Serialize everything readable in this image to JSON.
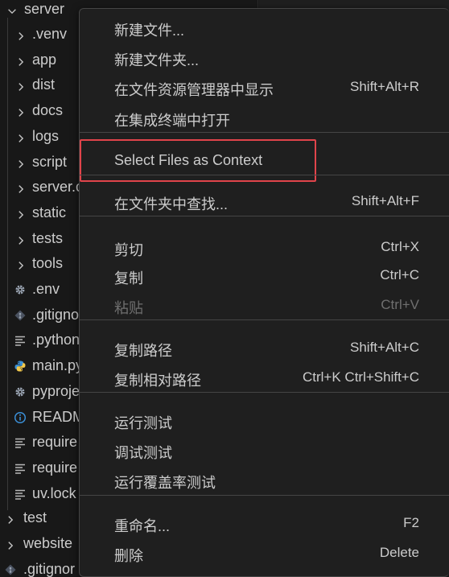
{
  "explorer": {
    "root": {
      "label": "server",
      "icon": "chevron-down-icon"
    },
    "items": [
      {
        "label": ".venv",
        "kind": "folder"
      },
      {
        "label": "app",
        "kind": "folder"
      },
      {
        "label": "dist",
        "kind": "folder"
      },
      {
        "label": "docs",
        "kind": "folder"
      },
      {
        "label": "logs",
        "kind": "folder"
      },
      {
        "label": "script",
        "kind": "folder"
      },
      {
        "label": "server.c",
        "kind": "folder"
      },
      {
        "label": "static",
        "kind": "folder"
      },
      {
        "label": "tests",
        "kind": "folder"
      },
      {
        "label": "tools",
        "kind": "folder"
      },
      {
        "label": ".env",
        "kind": "gear"
      },
      {
        "label": ".gitigno",
        "kind": "git"
      },
      {
        "label": ".python",
        "kind": "lines"
      },
      {
        "label": "main.py",
        "kind": "python"
      },
      {
        "label": "pyproje",
        "kind": "gear"
      },
      {
        "label": "READM",
        "kind": "info"
      },
      {
        "label": "require",
        "kind": "lines"
      },
      {
        "label": "require",
        "kind": "lines"
      },
      {
        "label": "uv.lock",
        "kind": "lines"
      }
    ],
    "siblings": [
      {
        "label": "test",
        "kind": "folder"
      },
      {
        "label": "website",
        "kind": "folder"
      },
      {
        "label": ".gitignor",
        "kind": "git"
      }
    ]
  },
  "menu": {
    "groups": [
      [
        {
          "label": "新建文件...",
          "shortcut": ""
        },
        {
          "label": "新建文件夹...",
          "shortcut": ""
        },
        {
          "label": "在文件资源管理器中显示",
          "shortcut": "Shift+Alt+R"
        },
        {
          "label": "在集成终端中打开",
          "shortcut": ""
        }
      ],
      [
        {
          "label": "Select Files as Context",
          "shortcut": ""
        }
      ],
      [
        {
          "label": "在文件夹中查找...",
          "shortcut": "Shift+Alt+F"
        }
      ],
      [
        {
          "label": "剪切",
          "shortcut": "Ctrl+X"
        },
        {
          "label": "复制",
          "shortcut": "Ctrl+C"
        },
        {
          "label": "粘贴",
          "shortcut": "Ctrl+V",
          "disabled": true
        }
      ],
      [
        {
          "label": "复制路径",
          "shortcut": "Shift+Alt+C"
        },
        {
          "label": "复制相对路径",
          "shortcut": "Ctrl+K Ctrl+Shift+C"
        }
      ],
      [
        {
          "label": "运行测试",
          "shortcut": ""
        },
        {
          "label": "调试测试",
          "shortcut": ""
        },
        {
          "label": "运行覆盖率测试",
          "shortcut": ""
        }
      ],
      [
        {
          "label": "重命名...",
          "shortcut": "F2"
        },
        {
          "label": "删除",
          "shortcut": "Delete"
        }
      ]
    ]
  },
  "colors": {
    "highlight_border": "#e0444b",
    "menu_bg": "#1f1f1f",
    "explorer_bg": "#181818",
    "python_icon": "#3b8fd6",
    "info_icon": "#3b8fd6"
  }
}
